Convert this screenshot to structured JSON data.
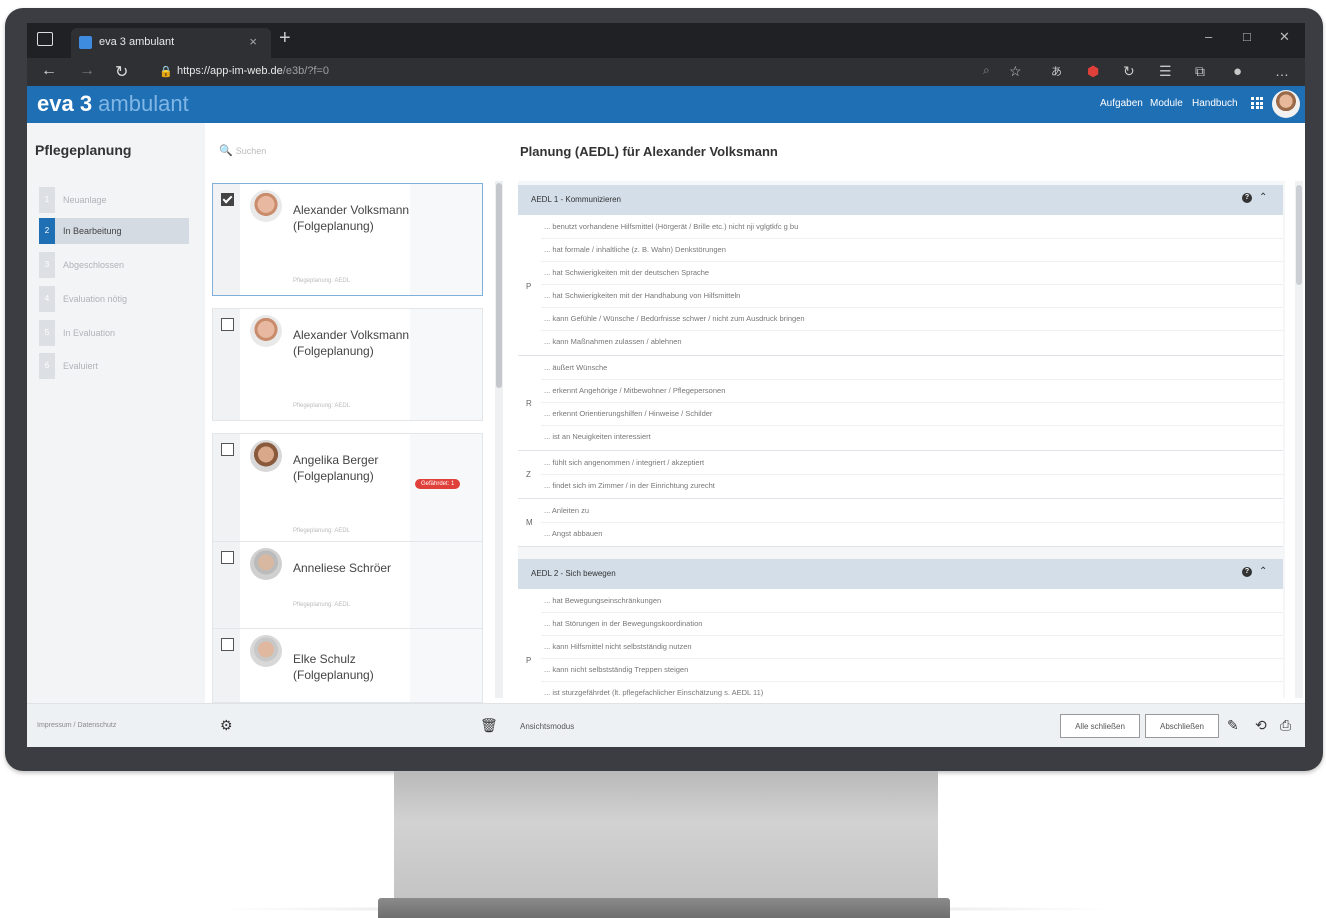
{
  "browser": {
    "tab_title": "eva 3 ambulant",
    "tab_close": "×",
    "new_tab": "+",
    "url_main": "https://app-im-web.de",
    "url_path": "/e3b/?f=0",
    "win_min": "–",
    "win_max": "□",
    "win_close": "✕"
  },
  "app": {
    "brand_bold": "eva 3",
    "brand_light": " ambulant",
    "nav": [
      "Aufgaben",
      "Module",
      "Handbuch"
    ]
  },
  "left": {
    "title": "Pflegeplanung",
    "steps": [
      {
        "num": "1",
        "label": "Neuanlage"
      },
      {
        "num": "2",
        "label": "In Bearbeitung"
      },
      {
        "num": "3",
        "label": "Abgeschlossen"
      },
      {
        "num": "4",
        "label": "Evaluation nötig"
      },
      {
        "num": "5",
        "label": "In Evaluation"
      },
      {
        "num": "6",
        "label": "Evaluiert"
      }
    ],
    "footer": "Impressum / Datenschutz"
  },
  "list": {
    "search_placeholder": "Suchen",
    "patients": [
      {
        "name": "Alexander Volksmann (Folgeplanung)",
        "sub": "Pflegeplanung: AEDL",
        "checked": true
      },
      {
        "name": "Alexander Volksmann (Folgeplanung)",
        "sub": "Pflegeplanung: AEDL",
        "checked": false
      },
      {
        "name": "Angelika Berger (Folgeplanung)",
        "sub": "Pflegeplanung: AEDL",
        "checked": false,
        "badge": "Gefährdet: 1"
      },
      {
        "name": "Anneliese Schröer",
        "sub": "Pflegeplanung: AEDL",
        "checked": false
      },
      {
        "name": "Elke Schulz (Folgeplanung)",
        "sub": "",
        "checked": false
      }
    ]
  },
  "planning": {
    "title": "Planung (AEDL) für Alexander Volksmann",
    "sections": [
      {
        "title": "AEDL 1 - Kommunizieren",
        "groups": [
          {
            "label": "P",
            "rows": [
              "... benutzt vorhandene Hilfsmittel (Hörgerät / Brille etc.) nicht nji vglgtkfc g bu",
              "... hat formale / inhaltliche (z. B. Wahn) Denkstörungen",
              "... hat Schwierigkeiten mit der deutschen Sprache",
              "... hat Schwierigkeiten mit der Handhabung von Hilfsmitteln",
              "... kann Gefühle / Wünsche / Bedürfnisse schwer / nicht zum Ausdruck bringen",
              "... kann Maßnahmen zulassen / ablehnen"
            ]
          },
          {
            "label": "R",
            "rows": [
              "... äußert Wünsche",
              "... erkennt Angehörige / Mitbewohner / Pflegepersonen",
              "... erkennt Orientierungshilfen / Hinweise / Schilder",
              "... ist an Neuigkeiten interessiert"
            ]
          },
          {
            "label": "Z",
            "rows": [
              "... fühlt sich angenommen / integriert / akzeptiert",
              "... findet sich im Zimmer / in der Einrichtung zurecht"
            ]
          },
          {
            "label": "M",
            "rows": [
              "... Anleiten zu",
              "... Angst abbauen"
            ]
          }
        ]
      },
      {
        "title": "AEDL 2 - Sich bewegen",
        "groups": [
          {
            "label": "P",
            "rows": [
              "... hat Bewegungseinschränkungen",
              "... hat Störungen in der Bewegungskoordination",
              "... kann Hilfsmittel nicht selbstständig nutzen",
              "... kann nicht selbstständig Treppen steigen",
              "... ist sturzgefährdet (lt. pflegefachlicher Einschätzung s. AEDL 11)"
            ]
          }
        ]
      }
    ]
  },
  "bottom": {
    "view_mode": "Ansichtsmodus",
    "close_all": "Alle schließen",
    "finish": "Abschließen"
  },
  "colors": {
    "accent": "#1f6fb5",
    "section_header": "#d3dee8",
    "badge": "#e0403a"
  }
}
